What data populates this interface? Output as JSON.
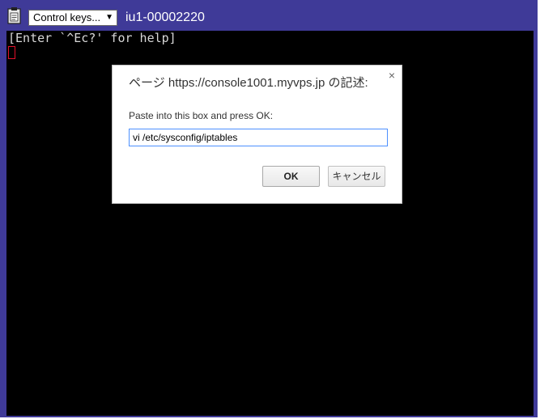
{
  "toolbar": {
    "clipboard_icon": "clipboard-icon",
    "control_keys_label": "Control keys...",
    "dropdown_arrow": "▼",
    "machine_id": "iu1-00002220"
  },
  "terminal": {
    "line1": "[Enter `^Ec?' for help]"
  },
  "dialog": {
    "title": "ページ https://console1001.myvps.jp の記述:",
    "close_symbol": "×",
    "prompt": "Paste into this box and press OK:",
    "input_value": "vi /etc/sysconfig/iptables",
    "ok_label": "OK",
    "cancel_label": "キャンセル"
  },
  "colors": {
    "frame": "#3f3a98",
    "terminal_bg": "#000000",
    "cursor": "#e0102a",
    "input_focus": "#4d90fe"
  }
}
